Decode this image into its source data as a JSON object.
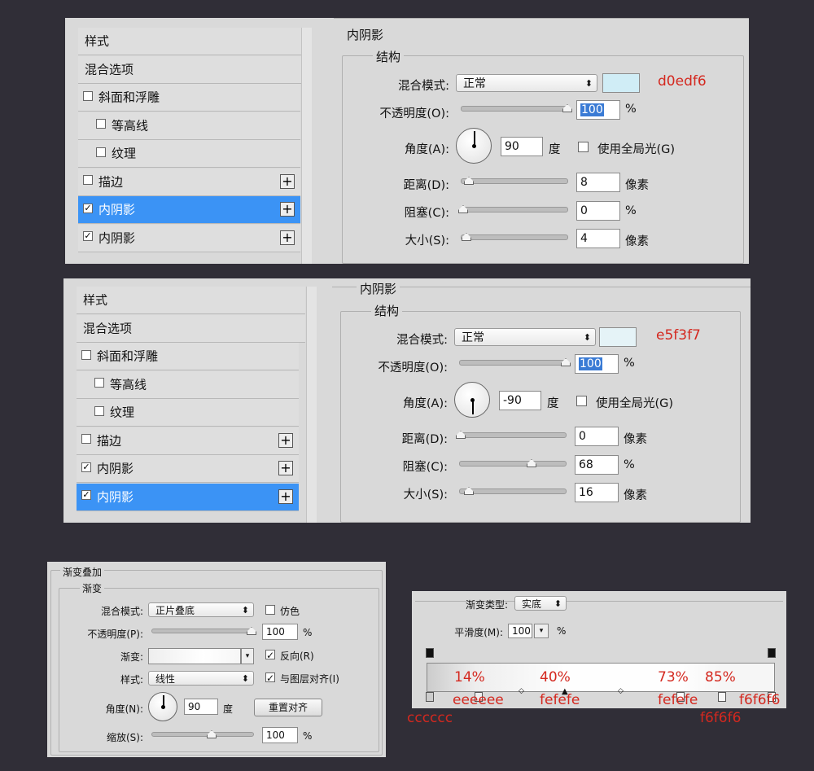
{
  "panel1": {
    "sidebar": [
      {
        "label": "样式",
        "checkbox": false,
        "indent": 0,
        "plus": false,
        "selected": false
      },
      {
        "label": "混合选项",
        "checkbox": false,
        "indent": 0,
        "plus": false,
        "selected": false
      },
      {
        "label": "斜面和浮雕",
        "checkbox": "unchecked",
        "indent": 0,
        "plus": false,
        "selected": false
      },
      {
        "label": "等高线",
        "checkbox": "unchecked",
        "indent": 1,
        "plus": false,
        "selected": false
      },
      {
        "label": "纹理",
        "checkbox": "unchecked",
        "indent": 1,
        "plus": false,
        "selected": false
      },
      {
        "label": "描边",
        "checkbox": "unchecked",
        "indent": 0,
        "plus": true,
        "selected": false
      },
      {
        "label": "内阴影",
        "checkbox": "checked",
        "indent": 0,
        "plus": true,
        "selected": true
      },
      {
        "label": "内阴影",
        "checkbox": "checked",
        "indent": 0,
        "plus": true,
        "selected": false
      }
    ],
    "title": "内阴影",
    "struct": "结构",
    "blend_label": "混合模式:",
    "blend_value": "正常",
    "swatch_color": "#d0edf6",
    "annotation": "d0edf6",
    "opacity_label": "不透明度(O):",
    "opacity_value": "100",
    "opacity_unit": "%",
    "angle_label": "角度(A):",
    "angle_value": "90",
    "angle_unit": "度",
    "global_light": "使用全局光(G)",
    "distance_label": "距离(D):",
    "distance_value": "8",
    "distance_unit": "像素",
    "choke_label": "阻塞(C):",
    "choke_value": "0",
    "choke_unit": "%",
    "size_label": "大小(S):",
    "size_value": "4",
    "size_unit": "像素"
  },
  "panel2": {
    "sidebar": [
      {
        "label": "样式",
        "checkbox": false,
        "indent": 0,
        "plus": false,
        "selected": false
      },
      {
        "label": "混合选项",
        "checkbox": false,
        "indent": 0,
        "plus": false,
        "selected": false
      },
      {
        "label": "斜面和浮雕",
        "checkbox": "unchecked",
        "indent": 0,
        "plus": false,
        "selected": false
      },
      {
        "label": "等高线",
        "checkbox": "unchecked",
        "indent": 1,
        "plus": false,
        "selected": false
      },
      {
        "label": "纹理",
        "checkbox": "unchecked",
        "indent": 1,
        "plus": false,
        "selected": false
      },
      {
        "label": "描边",
        "checkbox": "unchecked",
        "indent": 0,
        "plus": true,
        "selected": false
      },
      {
        "label": "内阴影",
        "checkbox": "checked",
        "indent": 0,
        "plus": true,
        "selected": false
      },
      {
        "label": "内阴影",
        "checkbox": "checked",
        "indent": 0,
        "plus": true,
        "selected": true
      }
    ],
    "title": "内阴影",
    "struct": "结构",
    "blend_label": "混合模式:",
    "blend_value": "正常",
    "swatch_color": "#e5f3f7",
    "annotation": "e5f3f7",
    "opacity_label": "不透明度(O):",
    "opacity_value": "100",
    "opacity_unit": "%",
    "angle_label": "角度(A):",
    "angle_value": "-90",
    "angle_unit": "度",
    "global_light": "使用全局光(G)",
    "distance_label": "距离(D):",
    "distance_value": "0",
    "distance_unit": "像素",
    "choke_label": "阻塞(C):",
    "choke_value": "68",
    "choke_unit": "%",
    "size_label": "大小(S):",
    "size_value": "16",
    "size_unit": "像素"
  },
  "panel3": {
    "title": "渐变叠加",
    "struct": "渐变",
    "blend_label": "混合模式:",
    "blend_value": "正片叠底",
    "dither": "仿色",
    "opacity_label": "不透明度(P):",
    "opacity_value": "100",
    "opacity_unit": "%",
    "gradient_label": "渐变:",
    "reverse": "反向(R)",
    "style_label": "样式:",
    "style_value": "线性",
    "align": "与图层对齐(I)",
    "angle_label": "角度(N):",
    "angle_value": "90",
    "angle_unit": "度",
    "reset_button": "重置对齐",
    "scale_label": "缩放(S):",
    "scale_value": "100",
    "scale_unit": "%"
  },
  "panel4": {
    "type_label": "渐变类型:",
    "type_value": "实底",
    "smooth_label": "平滑度(M):",
    "smooth_value": "100",
    "smooth_unit": "%",
    "stops": [
      {
        "pos": "14%",
        "color": "eeeeee"
      },
      {
        "pos": "40%",
        "color": "fefefe"
      },
      {
        "pos": "73%",
        "color": "fefefe"
      },
      {
        "pos": "85%",
        "color": "f6f6f6"
      }
    ],
    "start_color": "cccccc",
    "end_color": "f6f6f6"
  }
}
